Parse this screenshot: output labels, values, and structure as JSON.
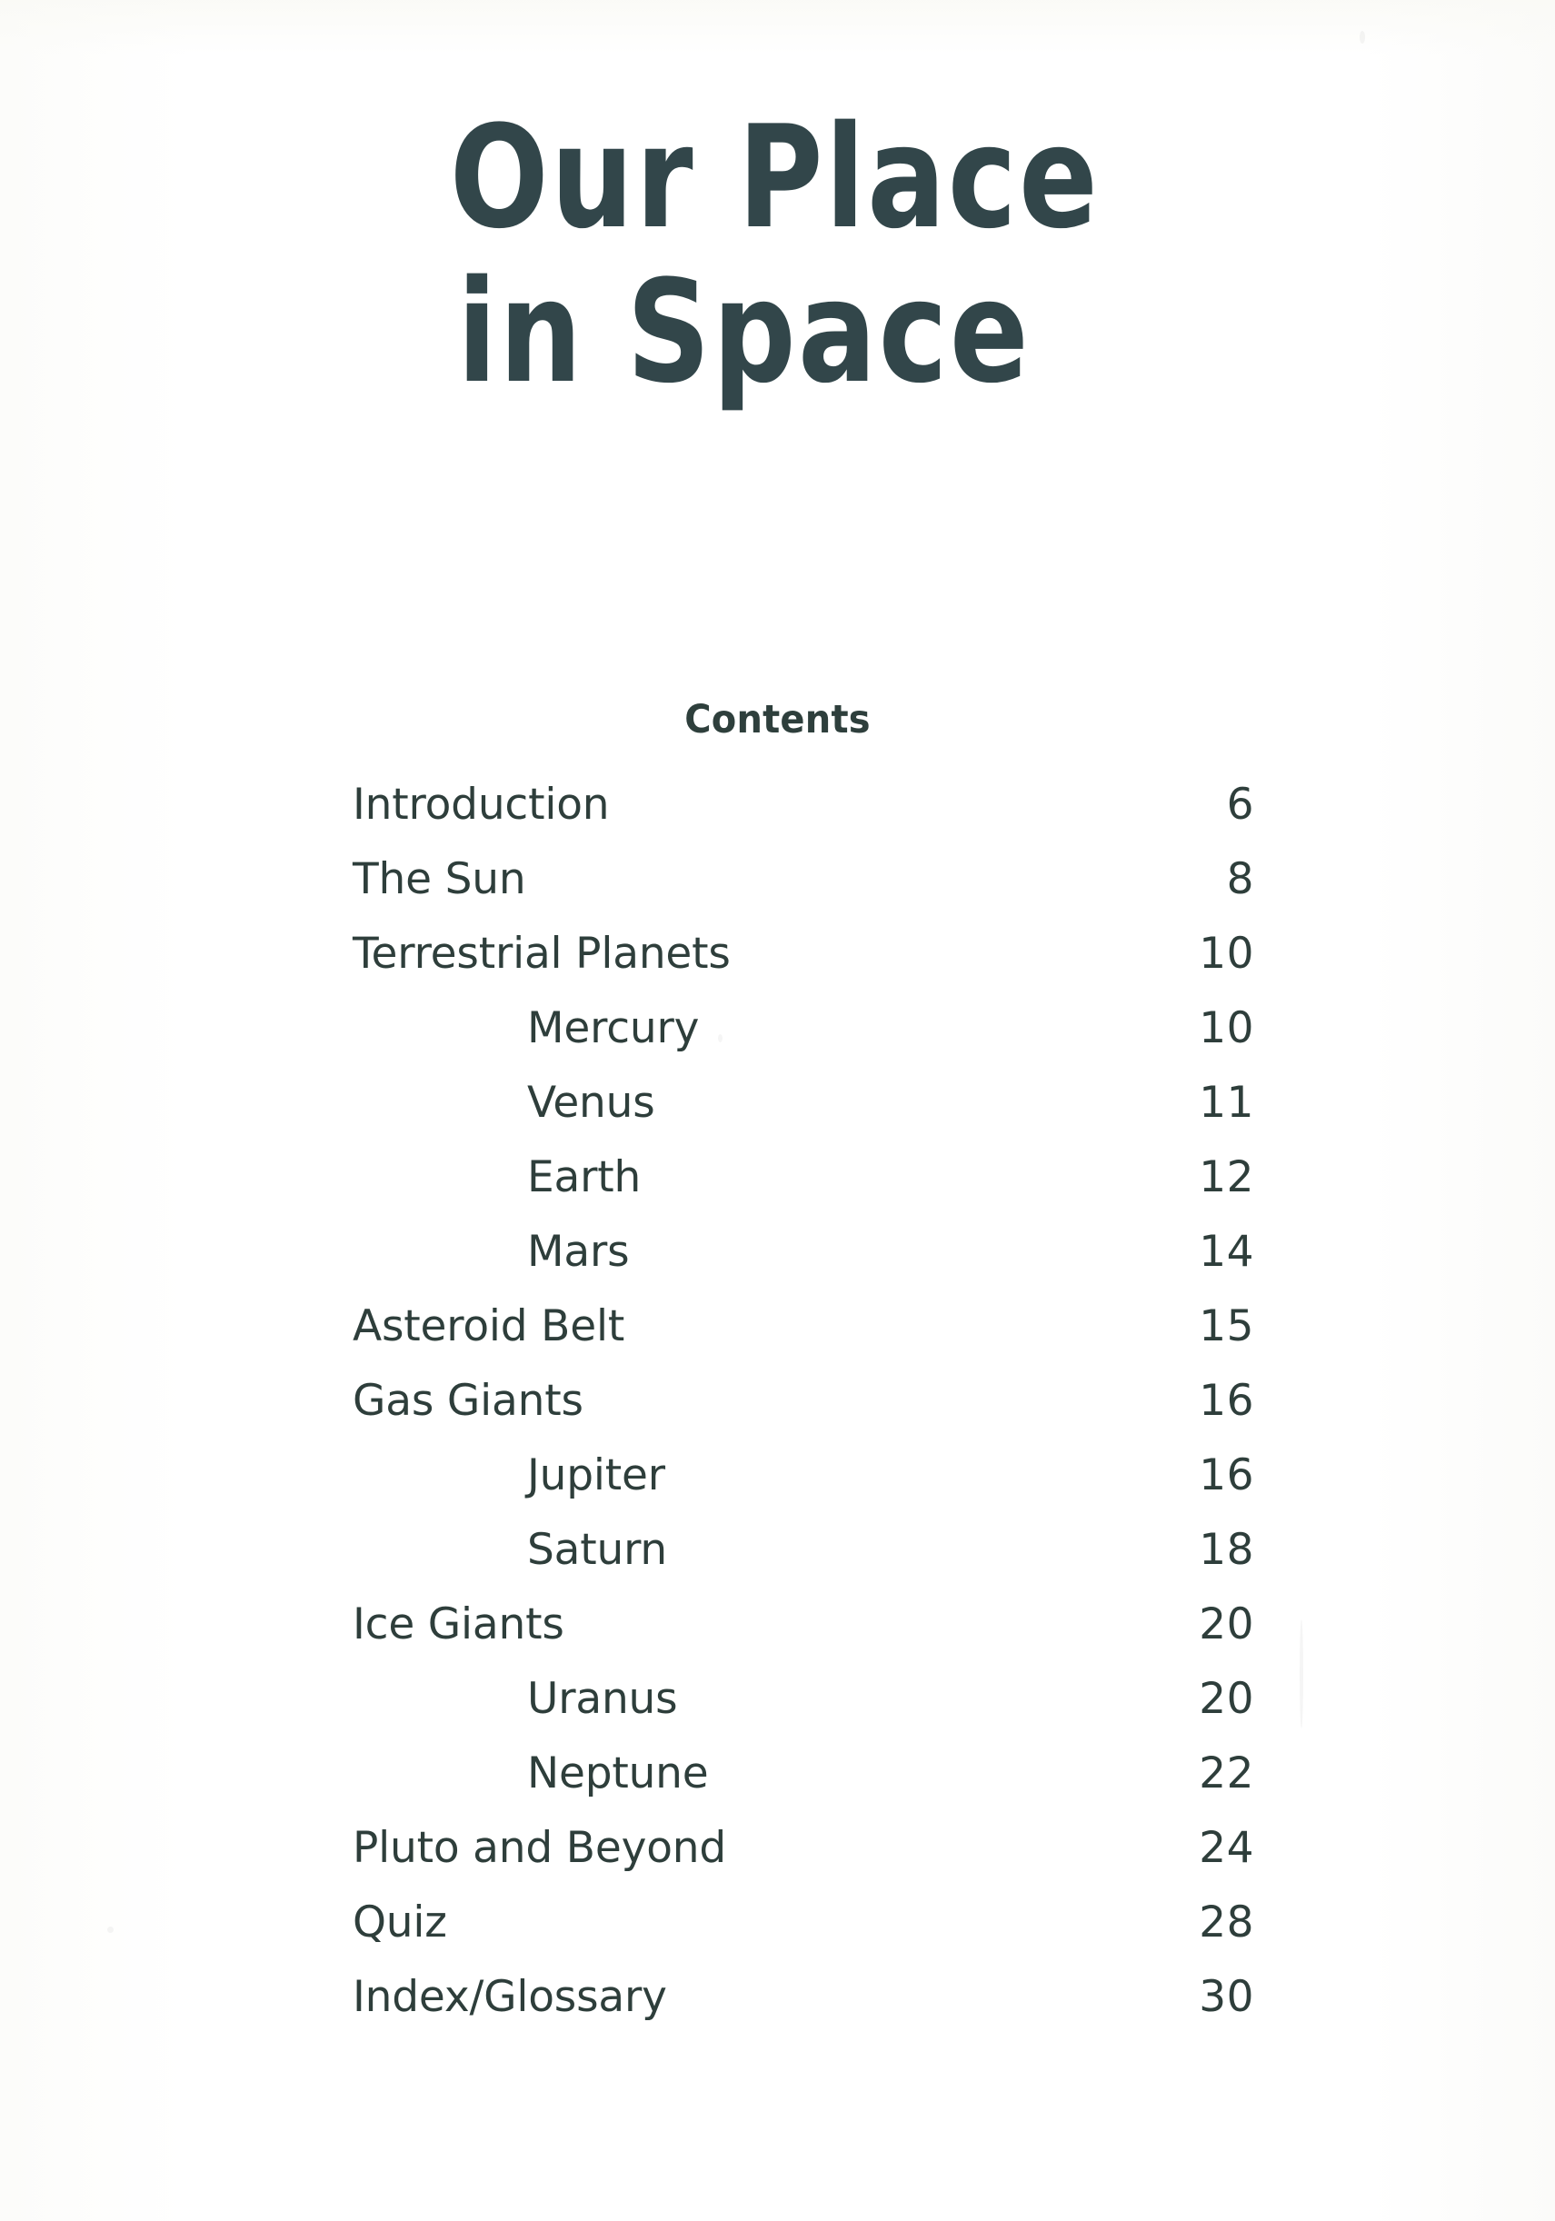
{
  "document": {
    "title_lines": [
      "Our Place",
      "in Space"
    ],
    "contents_heading": "Contents"
  },
  "colors": {
    "title": "#32464a",
    "body_text": "#2e3e3b",
    "page_background": "#fdfdfc"
  },
  "contents": {
    "entries": [
      {
        "label": "Introduction",
        "page": "6",
        "indent": false
      },
      {
        "label": "The Sun",
        "page": "8",
        "indent": false
      },
      {
        "label": "Terrestrial Planets",
        "page": "10",
        "indent": false
      },
      {
        "label": "Mercury",
        "page": "10",
        "indent": true
      },
      {
        "label": "Venus",
        "page": "11",
        "indent": true
      },
      {
        "label": "Earth",
        "page": "12",
        "indent": true
      },
      {
        "label": "Mars",
        "page": "14",
        "indent": true
      },
      {
        "label": "Asteroid Belt",
        "page": "15",
        "indent": false
      },
      {
        "label": "Gas Giants",
        "page": "16",
        "indent": false
      },
      {
        "label": "Jupiter",
        "page": "16",
        "indent": true
      },
      {
        "label": "Saturn",
        "page": "18",
        "indent": true
      },
      {
        "label": "Ice Giants",
        "page": "20",
        "indent": false
      },
      {
        "label": "Uranus",
        "page": "20",
        "indent": true
      },
      {
        "label": "Neptune",
        "page": "22",
        "indent": true
      },
      {
        "label": "Pluto and Beyond",
        "page": "24",
        "indent": false
      },
      {
        "label": "Quiz",
        "page": "28",
        "indent": false
      },
      {
        "label": "Index/Glossary",
        "page": "30",
        "indent": false
      }
    ]
  }
}
